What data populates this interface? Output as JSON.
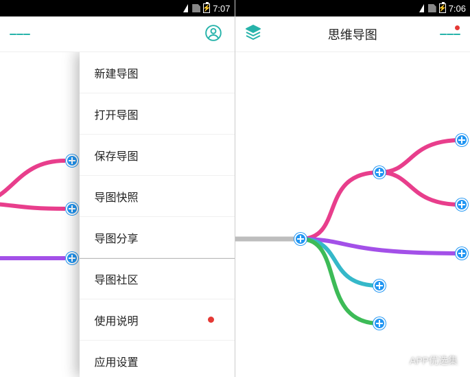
{
  "left": {
    "status_time": "7:07",
    "menu": {
      "items": [
        {
          "label": "新建导图"
        },
        {
          "label": "打开导图"
        },
        {
          "label": "保存导图"
        },
        {
          "label": "导图快照"
        },
        {
          "label": "导图分享"
        },
        {
          "label": "导图社区"
        },
        {
          "label": "使用说明",
          "dot": true
        },
        {
          "label": "应用设置"
        }
      ]
    }
  },
  "right": {
    "status_time": "7:06",
    "title": "思维导图"
  },
  "watermark": "APP优选集",
  "colors": {
    "accent": "#27b3aa",
    "pink": "#e83e8c",
    "purple": "#a350e8",
    "cyan": "#35b8c9",
    "green": "#3dbb57",
    "node": "#2196f3"
  }
}
